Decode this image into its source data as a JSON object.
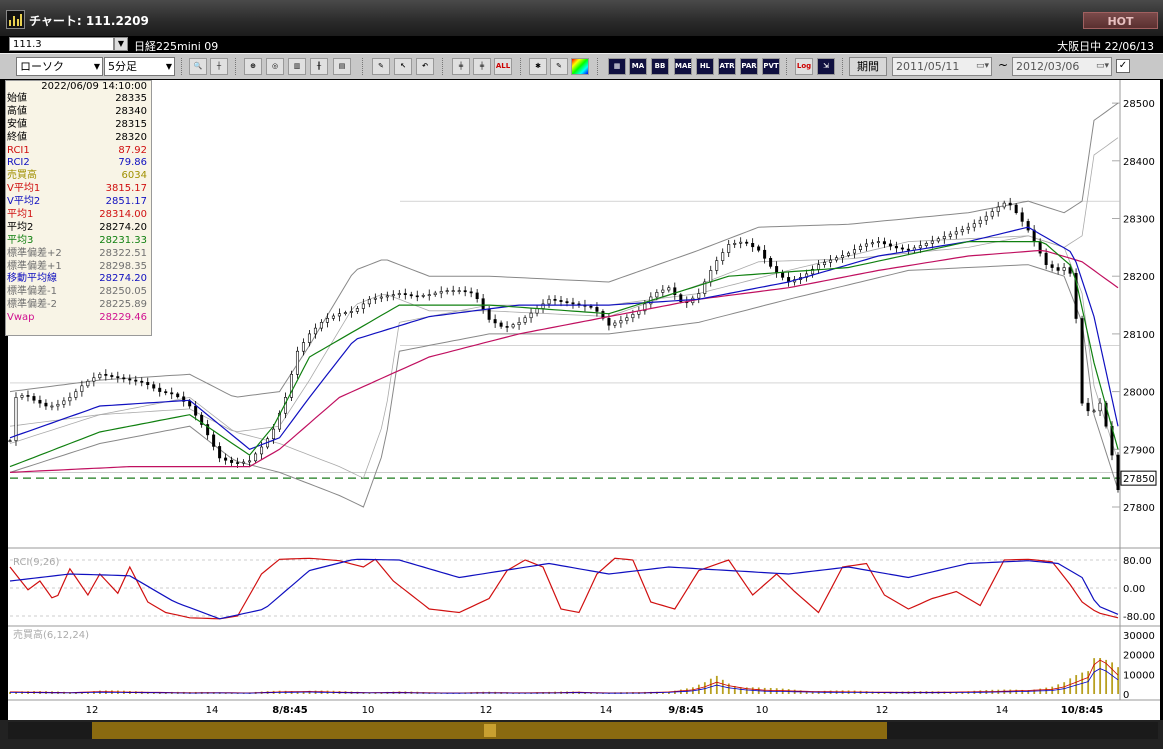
{
  "window": {
    "title": "チャート: 111.2209",
    "hot_label": "HOT"
  },
  "code_box": {
    "value": "111.3"
  },
  "instrument": "日経225mini 09",
  "session_text": "大阪日中  22/06/13",
  "toolbar": {
    "chart_type": "ローソク",
    "interval": "5分足",
    "period_label": "期間",
    "date_from": "2011/05/11",
    "date_to": "2012/03/06",
    "tilde": "~",
    "buttons_a": [
      "ALL"
    ],
    "buttons_b": [
      "MA",
      "BB",
      "MAE",
      "HL",
      "ATR",
      "PAR",
      "PVT",
      "Log"
    ]
  },
  "info_panel": {
    "timestamp": "2022/06/09  14:10:00",
    "rows": [
      {
        "label": "始値",
        "value": "28335",
        "color": "#000000"
      },
      {
        "label": "高値",
        "value": "28340",
        "color": "#000000"
      },
      {
        "label": "安値",
        "value": "28315",
        "color": "#000000"
      },
      {
        "label": "終値",
        "value": "28320",
        "color": "#000000"
      },
      {
        "label": "RCI1",
        "value": "87.92",
        "color": "#d01010"
      },
      {
        "label": "RCI2",
        "value": "79.86",
        "color": "#1010c0"
      },
      {
        "label": "売買高",
        "value": "6034",
        "color": "#a09000"
      },
      {
        "label": "V平均1",
        "value": "3815.17",
        "color": "#d01010"
      },
      {
        "label": "V平均2",
        "value": "2851.17",
        "color": "#1010c0"
      },
      {
        "label": "平均1",
        "value": "28314.00",
        "color": "#d01010"
      },
      {
        "label": "平均2",
        "value": "28274.20",
        "color": "#000000"
      },
      {
        "label": "平均3",
        "value": "28231.33",
        "color": "#108010"
      },
      {
        "label": "標準偏差+2",
        "value": "28322.51",
        "color": "#707070"
      },
      {
        "label": "標準偏差+1",
        "value": "28298.35",
        "color": "#707070"
      },
      {
        "label": "移動平均線",
        "value": "28274.20",
        "color": "#1010c0"
      },
      {
        "label": "標準偏差-1",
        "value": "28250.05",
        "color": "#707070"
      },
      {
        "label": "標準偏差-2",
        "value": "28225.89",
        "color": "#707070"
      },
      {
        "label": "Vwap",
        "value": "28229.46",
        "color": "#d01090"
      }
    ]
  },
  "chart_data": {
    "type": "candlestick",
    "price_axis": {
      "ticks": [
        27800,
        27900,
        28000,
        28100,
        28200,
        28300,
        28400,
        28500
      ],
      "labels": [
        "27800",
        "27900",
        "28000",
        "28100",
        "28200",
        "28300",
        "28400",
        "28500"
      ],
      "current_label": "27850",
      "current_value": 27850
    },
    "time_axis": {
      "labels": [
        "12",
        "14",
        "8/8:45",
        "10",
        "12",
        "14",
        "9/8:45",
        "10",
        "12",
        "14",
        "10/8:45"
      ]
    },
    "price_path": [
      [
        0,
        27915
      ],
      [
        2,
        27990
      ],
      [
        5,
        27995
      ],
      [
        8,
        27985
      ],
      [
        12,
        27975
      ],
      [
        15,
        27975
      ],
      [
        20,
        27990
      ],
      [
        25,
        28015
      ],
      [
        30,
        28030
      ],
      [
        35,
        28025
      ],
      [
        40,
        28020
      ],
      [
        45,
        28015
      ],
      [
        50,
        28000
      ],
      [
        55,
        27995
      ],
      [
        60,
        27975
      ],
      [
        65,
        27935
      ],
      [
        70,
        27885
      ],
      [
        75,
        27875
      ],
      [
        80,
        27880
      ],
      [
        85,
        27910
      ],
      [
        88,
        27935
      ],
      [
        92,
        27990
      ],
      [
        96,
        28070
      ],
      [
        100,
        28100
      ],
      [
        105,
        28125
      ],
      [
        110,
        28135
      ],
      [
        115,
        28140
      ],
      [
        120,
        28160
      ],
      [
        125,
        28165
      ],
      [
        130,
        28170
      ],
      [
        135,
        28165
      ],
      [
        140,
        28168
      ],
      [
        145,
        28175
      ],
      [
        150,
        28175
      ],
      [
        155,
        28170
      ],
      [
        160,
        28125
      ],
      [
        165,
        28110
      ],
      [
        170,
        28120
      ],
      [
        175,
        28140
      ],
      [
        180,
        28160
      ],
      [
        185,
        28155
      ],
      [
        190,
        28150
      ],
      [
        195,
        28145
      ],
      [
        200,
        28115
      ],
      [
        205,
        28125
      ],
      [
        210,
        28140
      ],
      [
        215,
        28170
      ],
      [
        220,
        28180
      ],
      [
        225,
        28150
      ],
      [
        230,
        28170
      ],
      [
        235,
        28220
      ],
      [
        240,
        28255
      ],
      [
        245,
        28260
      ],
      [
        250,
        28245
      ],
      [
        255,
        28210
      ],
      [
        260,
        28190
      ],
      [
        265,
        28200
      ],
      [
        270,
        28220
      ],
      [
        275,
        28230
      ],
      [
        280,
        28240
      ],
      [
        285,
        28255
      ],
      [
        290,
        28260
      ],
      [
        295,
        28250
      ],
      [
        300,
        28245
      ],
      [
        305,
        28255
      ],
      [
        310,
        28265
      ],
      [
        315,
        28275
      ],
      [
        320,
        28285
      ],
      [
        325,
        28300
      ],
      [
        330,
        28320
      ],
      [
        333,
        28330
      ],
      [
        336,
        28310
      ],
      [
        340,
        28280
      ],
      [
        343,
        28250
      ],
      [
        346,
        28220
      ],
      [
        350,
        28210
      ],
      [
        352,
        28215
      ],
      [
        355,
        28200
      ],
      [
        358,
        27980
      ],
      [
        361,
        27960
      ],
      [
        364,
        27980
      ],
      [
        367,
        27920
      ],
      [
        370,
        27830
      ]
    ],
    "sma_short": [
      [
        0,
        27870
      ],
      [
        30,
        27930
      ],
      [
        60,
        27960
      ],
      [
        80,
        27890
      ],
      [
        88,
        27940
      ],
      [
        100,
        28060
      ],
      [
        130,
        28150
      ],
      [
        160,
        28150
      ],
      [
        200,
        28135
      ],
      [
        240,
        28200
      ],
      [
        280,
        28215
      ],
      [
        320,
        28260
      ],
      [
        345,
        28260
      ],
      [
        355,
        28215
      ],
      [
        362,
        28050
      ],
      [
        370,
        27900
      ]
    ],
    "sma_mid": [
      [
        0,
        27920
      ],
      [
        30,
        27975
      ],
      [
        60,
        27985
      ],
      [
        80,
        27900
      ],
      [
        90,
        27920
      ],
      [
        100,
        27990
      ],
      [
        115,
        28090
      ],
      [
        140,
        28130
      ],
      [
        170,
        28150
      ],
      [
        200,
        28150
      ],
      [
        230,
        28160
      ],
      [
        260,
        28190
      ],
      [
        290,
        28235
      ],
      [
        320,
        28260
      ],
      [
        340,
        28285
      ],
      [
        355,
        28240
      ],
      [
        362,
        28130
      ],
      [
        370,
        27940
      ]
    ],
    "sma_long": [
      [
        0,
        27860
      ],
      [
        40,
        27870
      ],
      [
        80,
        27870
      ],
      [
        90,
        27900
      ],
      [
        110,
        27990
      ],
      [
        140,
        28060
      ],
      [
        170,
        28100
      ],
      [
        200,
        28130
      ],
      [
        230,
        28160
      ],
      [
        260,
        28180
      ],
      [
        290,
        28210
      ],
      [
        320,
        28235
      ],
      [
        345,
        28245
      ],
      [
        358,
        28225
      ],
      [
        370,
        28180
      ]
    ],
    "bb_upper": [
      [
        0,
        28000
      ],
      [
        30,
        28020
      ],
      [
        60,
        28030
      ],
      [
        75,
        27990
      ],
      [
        90,
        28000
      ],
      [
        100,
        28080
      ],
      [
        115,
        28210
      ],
      [
        125,
        28230
      ],
      [
        140,
        28200
      ],
      [
        160,
        28200
      ],
      [
        200,
        28190
      ],
      [
        230,
        28245
      ],
      [
        250,
        28285
      ],
      [
        280,
        28290
      ],
      [
        320,
        28310
      ],
      [
        340,
        28330
      ],
      [
        352,
        28310
      ],
      [
        358,
        28330
      ],
      [
        362,
        28470
      ],
      [
        370,
        28500
      ]
    ],
    "bb_lower": [
      [
        0,
        27860
      ],
      [
        30,
        27910
      ],
      [
        60,
        27940
      ],
      [
        75,
        27880
      ],
      [
        90,
        27860
      ],
      [
        100,
        27840
      ],
      [
        110,
        27820
      ],
      [
        118,
        27800
      ],
      [
        125,
        27900
      ],
      [
        130,
        28070
      ],
      [
        160,
        28100
      ],
      [
        200,
        28100
      ],
      [
        230,
        28120
      ],
      [
        260,
        28160
      ],
      [
        300,
        28210
      ],
      [
        340,
        28220
      ],
      [
        352,
        28200
      ],
      [
        358,
        28120
      ],
      [
        362,
        27960
      ],
      [
        370,
        27830
      ]
    ],
    "rci1": [
      [
        0,
        60
      ],
      [
        6,
        -5
      ],
      [
        10,
        20
      ],
      [
        15,
        -40
      ],
      [
        20,
        55
      ],
      [
        26,
        -20
      ],
      [
        30,
        40
      ],
      [
        36,
        -15
      ],
      [
        40,
        60
      ],
      [
        46,
        -40
      ],
      [
        52,
        -70
      ],
      [
        60,
        -85
      ],
      [
        70,
        -88
      ],
      [
        76,
        -80
      ],
      [
        84,
        40
      ],
      [
        90,
        82
      ],
      [
        100,
        85
      ],
      [
        110,
        78
      ],
      [
        118,
        60
      ],
      [
        122,
        82
      ],
      [
        128,
        20
      ],
      [
        134,
        -20
      ],
      [
        140,
        -60
      ],
      [
        150,
        -70
      ],
      [
        160,
        -30
      ],
      [
        166,
        50
      ],
      [
        172,
        80
      ],
      [
        178,
        60
      ],
      [
        184,
        -60
      ],
      [
        190,
        -70
      ],
      [
        196,
        40
      ],
      [
        202,
        85
      ],
      [
        208,
        80
      ],
      [
        214,
        -40
      ],
      [
        222,
        -60
      ],
      [
        230,
        50
      ],
      [
        240,
        80
      ],
      [
        248,
        -20
      ],
      [
        256,
        40
      ],
      [
        262,
        -10
      ],
      [
        270,
        -70
      ],
      [
        278,
        60
      ],
      [
        286,
        70
      ],
      [
        292,
        -20
      ],
      [
        300,
        -60
      ],
      [
        308,
        -30
      ],
      [
        316,
        -10
      ],
      [
        324,
        -50
      ],
      [
        332,
        80
      ],
      [
        340,
        82
      ],
      [
        348,
        75
      ],
      [
        354,
        10
      ],
      [
        358,
        -40
      ],
      [
        363,
        -70
      ],
      [
        370,
        -85
      ]
    ],
    "rci2": [
      [
        0,
        20
      ],
      [
        20,
        40
      ],
      [
        40,
        35
      ],
      [
        55,
        -40
      ],
      [
        70,
        -88
      ],
      [
        85,
        -60
      ],
      [
        100,
        50
      ],
      [
        115,
        82
      ],
      [
        130,
        80
      ],
      [
        150,
        30
      ],
      [
        165,
        50
      ],
      [
        180,
        70
      ],
      [
        200,
        40
      ],
      [
        220,
        60
      ],
      [
        240,
        50
      ],
      [
        260,
        40
      ],
      [
        280,
        60
      ],
      [
        300,
        30
      ],
      [
        320,
        70
      ],
      [
        340,
        78
      ],
      [
        350,
        70
      ],
      [
        358,
        30
      ],
      [
        363,
        -50
      ],
      [
        370,
        -75
      ]
    ],
    "rci_axis": {
      "labels": [
        "80.00",
        "0.00",
        "-80.00"
      ],
      "values": [
        80,
        0,
        -80
      ],
      "title": "RCI(9,26)"
    },
    "volume_axis": {
      "labels": [
        "30000",
        "20000",
        "10000",
        "0"
      ],
      "values": [
        30000,
        20000,
        10000,
        0
      ],
      "title": "売買高(6,12,24)"
    },
    "volume": [
      [
        0,
        1800
      ],
      [
        10,
        1500
      ],
      [
        20,
        1200
      ],
      [
        30,
        2000
      ],
      [
        40,
        1600
      ],
      [
        50,
        1400
      ],
      [
        60,
        1000
      ],
      [
        70,
        1200
      ],
      [
        80,
        900
      ],
      [
        90,
        1800
      ],
      [
        100,
        2200
      ],
      [
        110,
        1500
      ],
      [
        120,
        1200
      ],
      [
        130,
        1400
      ],
      [
        140,
        1000
      ],
      [
        150,
        900
      ],
      [
        160,
        1200
      ],
      [
        170,
        1000
      ],
      [
        180,
        1100
      ],
      [
        190,
        1500
      ],
      [
        200,
        900
      ],
      [
        210,
        1000
      ],
      [
        220,
        1800
      ],
      [
        228,
        3500
      ],
      [
        232,
        6000
      ],
      [
        236,
        10000
      ],
      [
        240,
        7000
      ],
      [
        246,
        4500
      ],
      [
        252,
        3200
      ],
      [
        258,
        2800
      ],
      [
        264,
        2400
      ],
      [
        270,
        2000
      ],
      [
        280,
        1800
      ],
      [
        290,
        1600
      ],
      [
        300,
        1400
      ],
      [
        310,
        1500
      ],
      [
        320,
        1800
      ],
      [
        330,
        2200
      ],
      [
        340,
        3000
      ],
      [
        348,
        4000
      ],
      [
        352,
        6000
      ],
      [
        356,
        10000
      ],
      [
        360,
        14000
      ],
      [
        363,
        30000
      ],
      [
        366,
        26000
      ],
      [
        370,
        16000
      ]
    ]
  }
}
